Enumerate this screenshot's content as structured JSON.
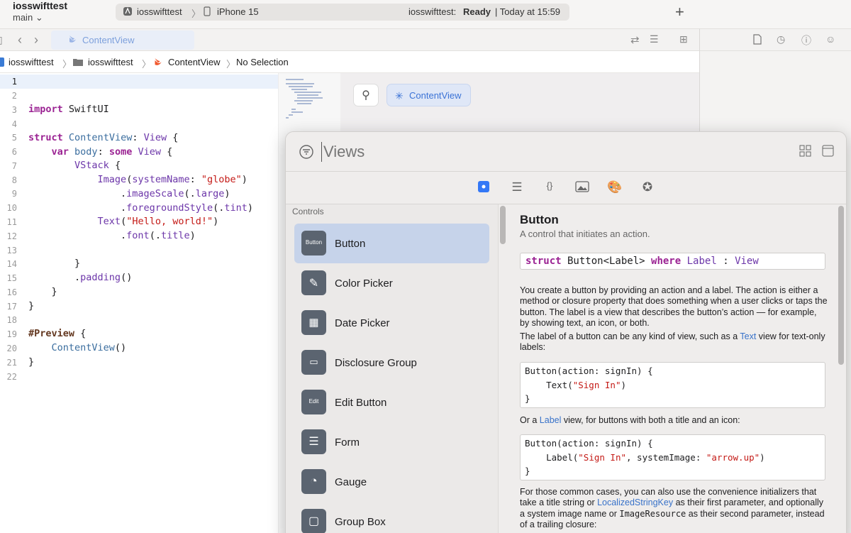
{
  "toolbar": {
    "project": "iosswifttest",
    "branch": "main",
    "scheme": "iosswifttest",
    "device": "iPhone 15",
    "status_prefix": "iosswifttest:",
    "status_ready": "Ready",
    "status_time": "| Today at 15:59",
    "add_label": "+"
  },
  "tabs": {
    "active": "ContentView"
  },
  "breadcrumb": {
    "project": "iosswifttest",
    "folder": "iosswifttest",
    "file": "ContentView",
    "selection": "No Selection"
  },
  "editor": {
    "line_numbers": [
      "1",
      "2",
      "3",
      "4",
      "5",
      "6",
      "7",
      "8",
      "9",
      "10",
      "11",
      "12",
      "13",
      "14",
      "15",
      "16",
      "17",
      "18",
      "19",
      "20",
      "21",
      "22"
    ]
  },
  "canvas": {
    "preview_chip": "ContentView"
  },
  "library": {
    "search_placeholder": "Views",
    "section": "Controls",
    "items": [
      {
        "label": "Button",
        "icon": "Button"
      },
      {
        "label": "Color Picker",
        "icon": ""
      },
      {
        "label": "Date Picker",
        "icon": ""
      },
      {
        "label": "Disclosure Group",
        "icon": ""
      },
      {
        "label": "Edit Button",
        "icon": "Edit"
      },
      {
        "label": "Form",
        "icon": ""
      },
      {
        "label": "Gauge",
        "icon": ""
      },
      {
        "label": "Group Box",
        "icon": ""
      }
    ],
    "detail": {
      "title": "Button",
      "subtitle": "A control that initiates an action.",
      "p1": "You create a button by providing an action and a label. The action is either a method or closure property that does something when a user clicks or taps the button. The label is a view that describes the button’s action — for example, by showing text, an icon, or both.",
      "p2_a": "The label of a button can be any kind of view, such as a ",
      "p2_link": "Text",
      "p2_b": " view for text-only labels:",
      "p3_a": "Or a ",
      "p3_link": "Label",
      "p3_b": " view, for buttons with both a title and an icon:",
      "p4_a": "For those common cases, you can also use the convenience initializers that take a title string or ",
      "p4_link": "LocalizedStringKey",
      "p4_b": " as their first parameter, and optionally a system image name or ",
      "p4_mono": "ImageResource",
      "p4_c": " as their second parameter, instead of a trailing closure:"
    }
  }
}
